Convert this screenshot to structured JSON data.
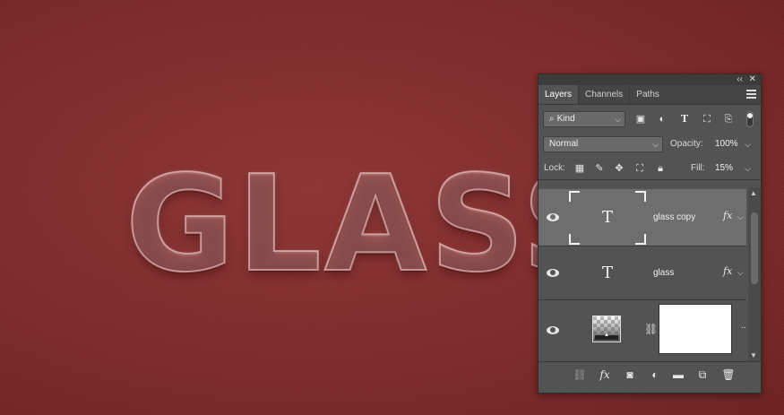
{
  "canvas": {
    "text": "GLASS"
  },
  "panel": {
    "top_controls": {
      "collapse": "‹‹",
      "close": "✕"
    },
    "tabs": [
      {
        "label": "Layers",
        "active": true
      },
      {
        "label": "Channels",
        "active": false
      },
      {
        "label": "Paths",
        "active": false
      }
    ],
    "filter": {
      "kind": "Kind",
      "kind_icon": "search-icon"
    },
    "blend_mode": "Normal",
    "opacity_label": "Opacity:",
    "opacity_value": "100%",
    "lock_label": "Lock:",
    "fill_label": "Fill:",
    "fill_value": "15%",
    "layers": [
      {
        "name": "glass copy",
        "type": "text",
        "thumb_glyph": "T",
        "fx": "fx",
        "selected": true
      },
      {
        "name": "glass",
        "type": "text",
        "thumb_glyph": "T",
        "fx": "fx",
        "selected": false
      },
      {
        "name": "",
        "type": "adjustment",
        "more": ".."
      }
    ],
    "colors": {
      "panel_bg": "#535353",
      "selected_row": "#6e6e6e",
      "canvas_bg": "#7f2b2b"
    }
  }
}
